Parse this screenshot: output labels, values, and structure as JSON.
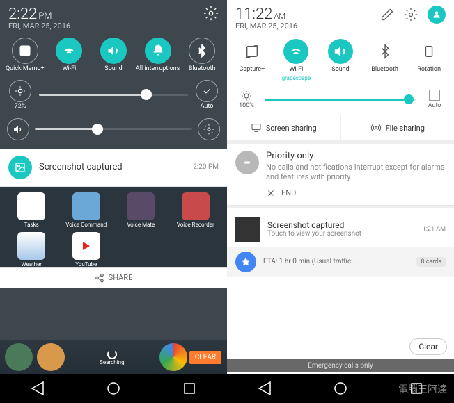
{
  "left": {
    "time": "2:22",
    "ampm": "PM",
    "date": "FRI, MAR 25, 2016",
    "toggles": [
      {
        "label": "Quick Memo+",
        "on": false,
        "icon": "memo"
      },
      {
        "label": "Wi-Fi",
        "on": true,
        "icon": "wifi"
      },
      {
        "label": "Sound",
        "on": true,
        "icon": "sound"
      },
      {
        "label": "All interruptions",
        "on": true,
        "icon": "bell"
      },
      {
        "label": "Bluetooth",
        "on": false,
        "icon": "bt"
      }
    ],
    "brightness": {
      "label": "72%",
      "value": 72,
      "auto_label": "Auto"
    },
    "volume": {
      "value": 40
    },
    "notification": {
      "title": "Screenshot captured",
      "time": "2:20 PM"
    },
    "apps": [
      "Tasks",
      "Voice Command",
      "Voice Mate",
      "Voice Recorder",
      "Weather",
      "YouTube"
    ],
    "share_label": "SHARE",
    "dock_label": "Searching",
    "clear_label": "CLEAR"
  },
  "right": {
    "time": "11:22",
    "ampm": "AM",
    "date": "FRI, MAR 25, 2016",
    "toggles": [
      {
        "label": "Capture+",
        "sub": "",
        "on": false,
        "icon": "capture"
      },
      {
        "label": "Wi-Fi",
        "sub": "grapescape",
        "on": true,
        "icon": "wifi"
      },
      {
        "label": "Sound",
        "sub": "",
        "on": true,
        "icon": "sound"
      },
      {
        "label": "Bluetooth",
        "sub": "",
        "on": false,
        "icon": "bt"
      },
      {
        "label": "Rotation",
        "sub": "",
        "on": false,
        "icon": "rotate"
      }
    ],
    "brightness": {
      "label": "100%",
      "value": 100,
      "auto_label": "Auto"
    },
    "screen_sharing": "Screen sharing",
    "file_sharing": "File sharing",
    "priority": {
      "title": "Priority only",
      "text": "No calls and notifications interrupt except for alarms and features with priority",
      "end": "END"
    },
    "screenshot": {
      "title": "Screenshot captured",
      "sub": "Touch to view your screenshot",
      "time": "11:21 AM"
    },
    "maps": {
      "text": "ETA: 1 hr 0 min (Usual traffic:...",
      "cards": "8 cards"
    },
    "clear": "Clear",
    "emergency": "Emergency calls only"
  },
  "watermark": "電腦王阿達"
}
